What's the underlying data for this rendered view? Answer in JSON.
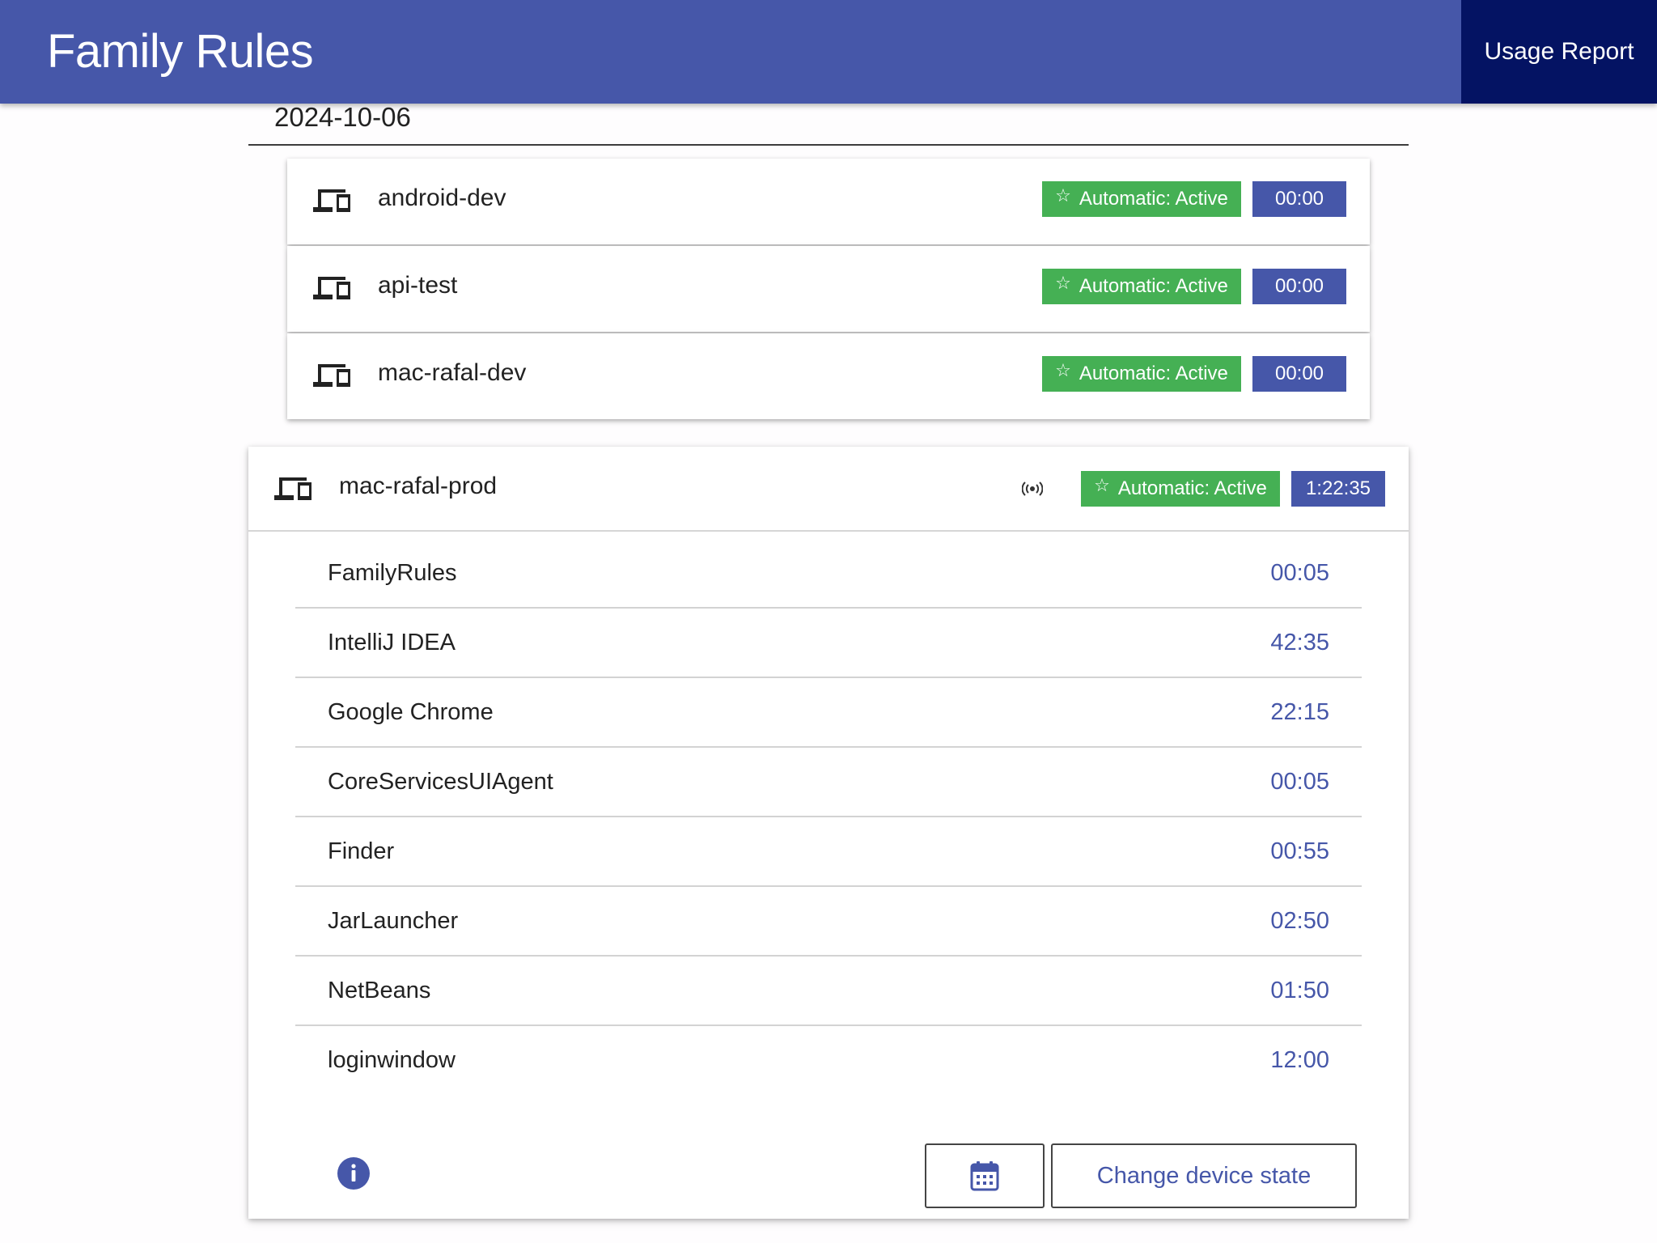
{
  "header": {
    "title": "Family Rules",
    "usage_report": "Usage Report"
  },
  "date": "2024-10-06",
  "devices": [
    {
      "name": "android-dev",
      "status": "Automatic: Active",
      "time": "00:00"
    },
    {
      "name": "api-test",
      "status": "Automatic: Active",
      "time": "00:00"
    },
    {
      "name": "mac-rafal-dev",
      "status": "Automatic: Active",
      "time": "00:00"
    }
  ],
  "expanded_device": {
    "name": "mac-rafal-prod",
    "status": "Automatic: Active",
    "time": "1:22:35",
    "apps": [
      {
        "name": "FamilyRules",
        "time": "00:05"
      },
      {
        "name": "IntelliJ IDEA",
        "time": "42:35"
      },
      {
        "name": "Google Chrome",
        "time": "22:15"
      },
      {
        "name": "CoreServicesUIAgent",
        "time": "00:05"
      },
      {
        "name": "Finder",
        "time": "00:55"
      },
      {
        "name": "JarLauncher",
        "time": "02:50"
      },
      {
        "name": "NetBeans",
        "time": "01:50"
      },
      {
        "name": "loginwindow",
        "time": "12:00"
      }
    ],
    "change_state_label": "Change device state"
  },
  "icons": {
    "device": "devices-icon",
    "status": "star-outline-icon",
    "online": "signal-broadcast-icon",
    "info": "info-icon",
    "calendar": "calendar-icon"
  },
  "colors": {
    "primary": "#4657a9",
    "nav_active": "#041363",
    "active_badge": "#45b054"
  }
}
